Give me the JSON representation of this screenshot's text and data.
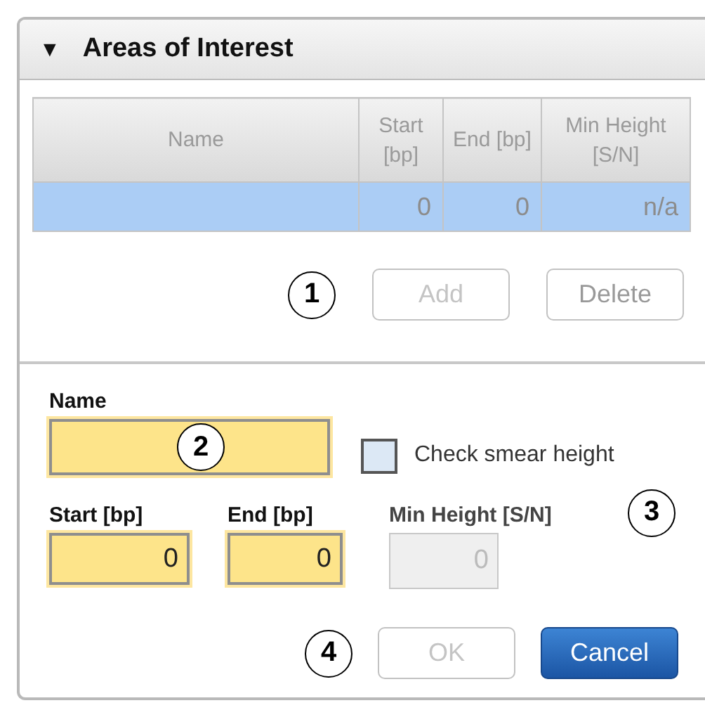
{
  "panel": {
    "title": "Areas of Interest",
    "expanded": true,
    "toggle": "▼"
  },
  "table": {
    "columns": [
      "Name",
      "Start [bp]",
      "End [bp]",
      "Min Height [S/N]"
    ],
    "rows": [
      {
        "selected": true,
        "cells": [
          "",
          "0",
          "0",
          "n/a"
        ]
      }
    ]
  },
  "table_buttons": {
    "callout": "1",
    "buttons": [
      {
        "label": "Add",
        "disabled": true
      },
      {
        "label": "Delete",
        "disabled": false
      }
    ]
  },
  "form": {
    "name": {
      "label": "Name",
      "required": true,
      "callout": "2"
    },
    "checkbox": {
      "label": "Check smear height",
      "checked": false,
      "callout": "3"
    },
    "fields": [
      {
        "label": "Start [bp]",
        "value": "0",
        "required": true,
        "disabled": false
      },
      {
        "label": "End [bp]",
        "value": "0",
        "required": true,
        "disabled": false
      },
      {
        "label": "Min Height [S/N]",
        "value": "0",
        "disabled": true
      }
    ]
  },
  "dialog_buttons": {
    "callout": "4",
    "buttons": [
      {
        "label": "OK",
        "kind": "plain",
        "disabled": true
      },
      {
        "label": "Cancel",
        "kind": "primary",
        "disabled": false
      }
    ]
  }
}
